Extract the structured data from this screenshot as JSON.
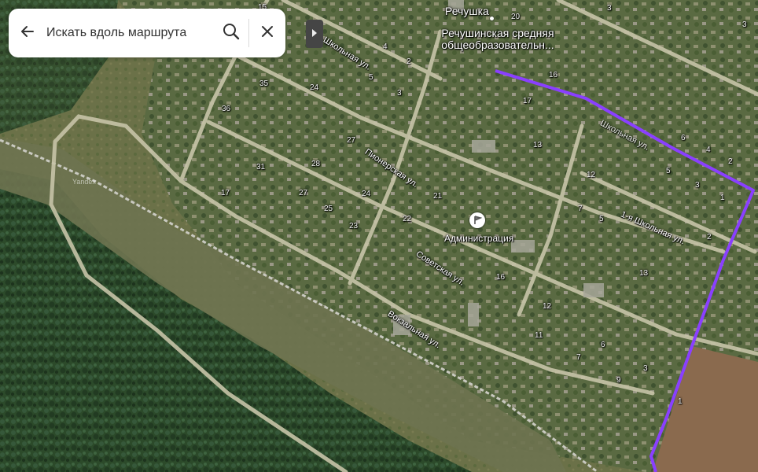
{
  "search": {
    "placeholder": "Искать вдоль маршрута"
  },
  "icons": {
    "back": "arrow-left-icon",
    "search": "search-icon",
    "close": "close-icon",
    "collapse": "chevron-right-icon",
    "admin": "flag-icon"
  },
  "colors": {
    "route": "#8a3fff"
  },
  "pois": {
    "village": "Речушка",
    "school": "Речушинская средняя общеобразовательн...",
    "admin": "Администрация"
  },
  "streets": {
    "shkolnaya": "Школьная ул.",
    "pionerskaya": "Пионерская ул.",
    "first_shkolnaya": "1-я Школьная ул.",
    "sovetskaya": "Советская ул.",
    "vokzalnaya": "Вокзальная ул.",
    "route_street": "Школьная ул."
  },
  "houses": [
    {
      "id": "h15",
      "text": "15"
    },
    {
      "id": "h20",
      "text": "20"
    },
    {
      "id": "h3t",
      "text": "3"
    },
    {
      "id": "h4a",
      "text": "4"
    },
    {
      "id": "h2a",
      "text": "2"
    },
    {
      "id": "h5a",
      "text": "5"
    },
    {
      "id": "h3a",
      "text": "3"
    },
    {
      "id": "h16a",
      "text": "16"
    },
    {
      "id": "h35",
      "text": "35"
    },
    {
      "id": "h24a",
      "text": "24"
    },
    {
      "id": "h36",
      "text": "36"
    },
    {
      "id": "h17a",
      "text": "17"
    },
    {
      "id": "h27a",
      "text": "27"
    },
    {
      "id": "h31",
      "text": "31"
    },
    {
      "id": "h28",
      "text": "28"
    },
    {
      "id": "h13",
      "text": "13"
    },
    {
      "id": "h17b",
      "text": "17"
    },
    {
      "id": "h27b",
      "text": "27"
    },
    {
      "id": "h24b",
      "text": "24"
    },
    {
      "id": "h21",
      "text": "21"
    },
    {
      "id": "h25",
      "text": "25"
    },
    {
      "id": "h23",
      "text": "23"
    },
    {
      "id": "h22",
      "text": "22"
    },
    {
      "id": "h12a",
      "text": "12"
    },
    {
      "id": "h6a",
      "text": "6"
    },
    {
      "id": "h4b",
      "text": "4"
    },
    {
      "id": "h2b",
      "text": "2"
    },
    {
      "id": "h5b",
      "text": "5"
    },
    {
      "id": "h3b",
      "text": "3"
    },
    {
      "id": "h1a",
      "text": "1"
    },
    {
      "id": "h7a",
      "text": "7"
    },
    {
      "id": "h5c",
      "text": "5"
    },
    {
      "id": "h2c",
      "text": "2"
    },
    {
      "id": "h13b",
      "text": "13"
    },
    {
      "id": "h16b",
      "text": "16"
    },
    {
      "id": "h12b",
      "text": "12"
    },
    {
      "id": "h11",
      "text": "11"
    },
    {
      "id": "h6b",
      "text": "6"
    },
    {
      "id": "h7b",
      "text": "7"
    },
    {
      "id": "h9",
      "text": "9"
    },
    {
      "id": "h3c",
      "text": "3"
    },
    {
      "id": "h1b",
      "text": "1"
    },
    {
      "id": "h3d",
      "text": "3"
    }
  ],
  "watermark": "Yandex"
}
